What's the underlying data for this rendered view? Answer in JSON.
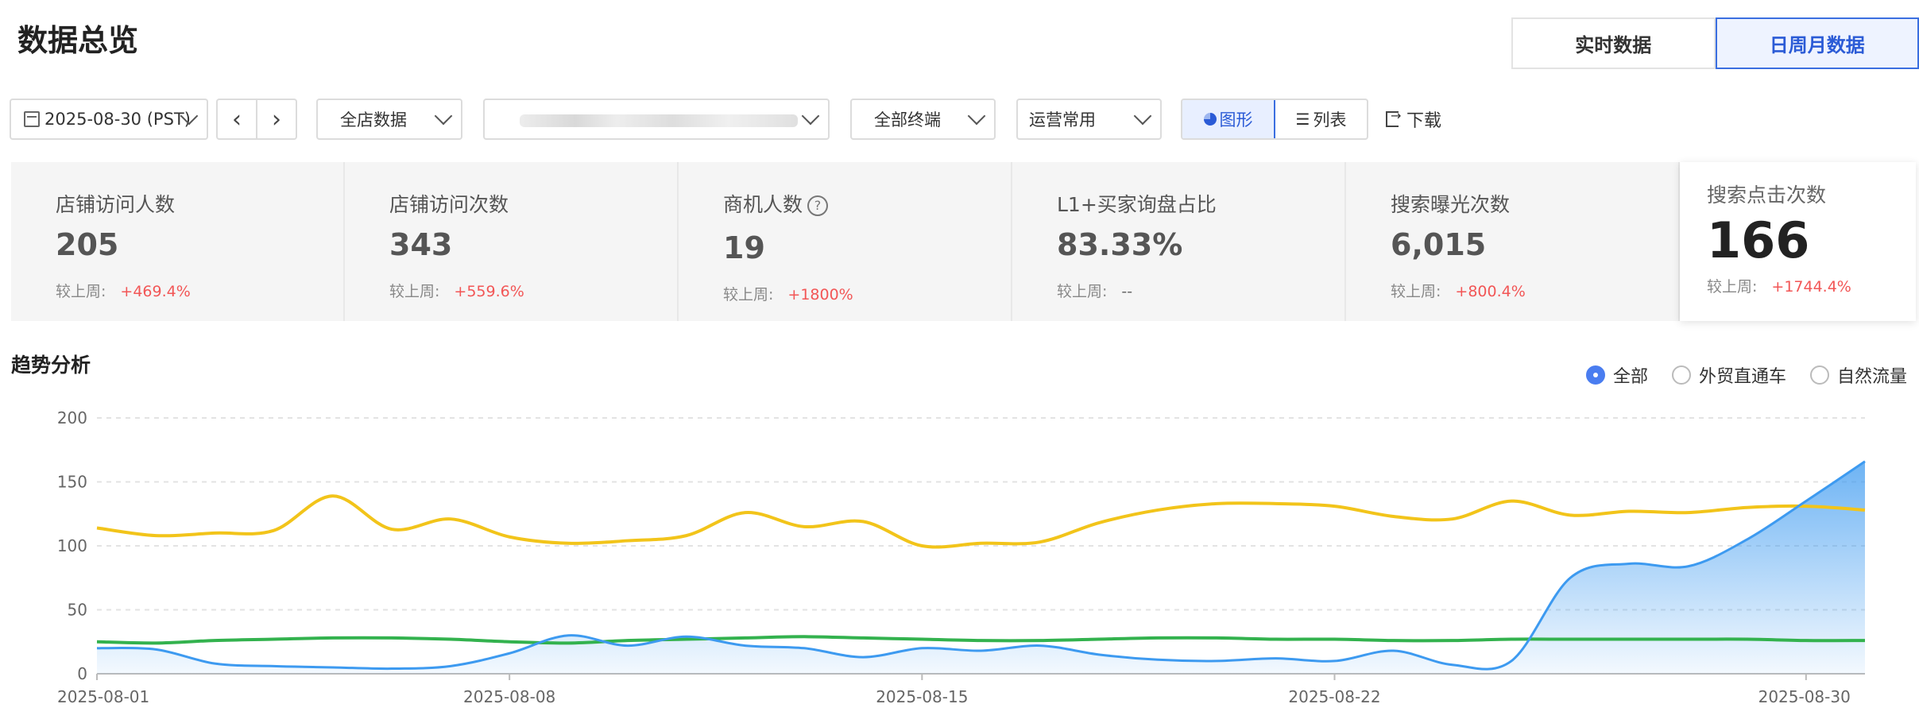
{
  "header": {
    "title": "数据总览",
    "tabs": [
      {
        "label": "实时数据",
        "active": false
      },
      {
        "label": "日周月数据",
        "active": true
      }
    ]
  },
  "toolbar": {
    "date": "2025-08-30 (PST)",
    "prev_icon": "chevron-left-icon",
    "next_icon": "chevron-right-icon",
    "store_select": "全店数据",
    "terminal_select": "全部终端",
    "ops_select": "运营常用",
    "view_chart": "图形",
    "view_list": "列表",
    "download": "下载"
  },
  "metrics": [
    {
      "label": "店铺访问人数",
      "value": "205",
      "cmp_label": "较上周:",
      "cmp_value": "+469.4%"
    },
    {
      "label": "店铺访问次数",
      "value": "343",
      "cmp_label": "较上周:",
      "cmp_value": "+559.6%"
    },
    {
      "label": "商机人数",
      "value": "19",
      "cmp_label": "较上周:",
      "cmp_value": "+1800%"
    },
    {
      "label": "L1+买家询盘占比",
      "value": "83.33%",
      "cmp_label": "较上周:",
      "cmp_value": "--"
    },
    {
      "label": "搜索曝光次数",
      "value": "6,015",
      "cmp_label": "较上周:",
      "cmp_value": "+800.4%"
    },
    {
      "label": "搜索点击次数",
      "value": "166",
      "cmp_label": "较上周:",
      "cmp_value": "+1744.4%"
    }
  ],
  "trend": {
    "title": "趋势分析",
    "filters": [
      {
        "label": "全部",
        "selected": true
      },
      {
        "label": "外贸直通车",
        "selected": false
      },
      {
        "label": "自然流量",
        "selected": false
      }
    ]
  },
  "chart_data": {
    "type": "line",
    "ylim": [
      0,
      200
    ],
    "yticks": [
      0,
      50,
      100,
      150,
      200
    ],
    "grid": true,
    "x_ticks": [
      "2025-08-01",
      "2025-08-08",
      "2025-08-15",
      "2025-08-22",
      "2025-08-30"
    ],
    "x_tick_index": [
      0,
      7,
      14,
      21,
      29
    ],
    "series": [
      {
        "color": "#f2c41a",
        "style": "line",
        "values": [
          114,
          108,
          110,
          112,
          139,
          113,
          121,
          107,
          102,
          104,
          108,
          126,
          115,
          119,
          100,
          102,
          103,
          118,
          128,
          133,
          133,
          131,
          123,
          121,
          135,
          124,
          127,
          126,
          130,
          131,
          128
        ]
      },
      {
        "color": "#33b24e",
        "style": "line",
        "values": [
          25,
          24,
          26,
          27,
          28,
          28,
          27,
          25,
          24,
          26,
          27,
          28,
          29,
          28,
          27,
          26,
          26,
          27,
          28,
          28,
          27,
          27,
          26,
          26,
          27,
          27,
          27,
          27,
          27,
          26,
          26
        ]
      },
      {
        "color": "#3d9af0",
        "style": "area",
        "values": [
          20,
          19,
          8,
          6,
          5,
          4,
          6,
          16,
          30,
          22,
          29,
          22,
          20,
          13,
          20,
          18,
          22,
          15,
          11,
          10,
          12,
          10,
          18,
          7,
          10,
          75,
          86,
          84,
          105,
          135,
          166
        ]
      }
    ]
  }
}
